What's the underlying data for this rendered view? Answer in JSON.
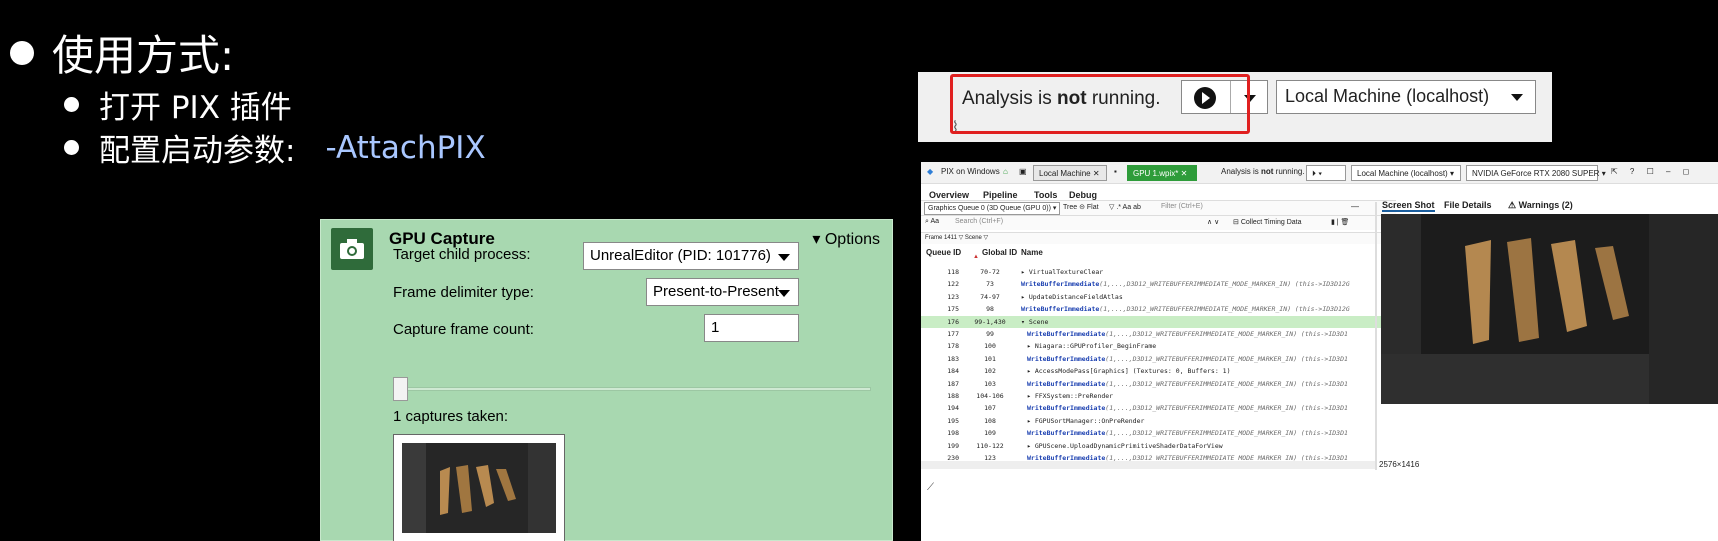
{
  "slide": {
    "title": "使用方式:",
    "bullets": [
      "打开 PIX 插件",
      "配置启动参数:"
    ],
    "param": "-AttachPIX"
  },
  "gpu_capture": {
    "title": "GPU Capture",
    "options_label": "Options",
    "target_label": "Target child process:",
    "target_value": "UnrealEditor (PID: 101776)",
    "delimiter_label": "Frame delimiter type:",
    "delimiter_value": "Present-to-Present",
    "count_label": "Capture frame count:",
    "count_value": "1",
    "captures_label": "1 captures taken:"
  },
  "analysis_bar": {
    "status_prefix": "Analysis is ",
    "status_bold": "not",
    "status_suffix": " running.",
    "machine": "Local Machine (localhost)"
  },
  "pix": {
    "app_title": "PIX on Windows",
    "tab_local": "Local Machine",
    "tab_capture": "GPU 1.wpix*",
    "status_prefix": "Analysis is ",
    "status_bold": "not",
    "status_suffix": " running.",
    "machine": "Local Machine (localhost)",
    "gpu": "NVIDIA GeForce RTX 2080 SUPER",
    "menus": [
      "Overview",
      "Pipeline",
      "Tools",
      "Debug"
    ],
    "queue_select": "Graphics Queue 0 (3D Queue (GPU 0))",
    "tree_label": "Tree",
    "flat_label": "Flat",
    "filter_placeholder": "Filter (Ctrl+E)",
    "search_placeholder": "Search (Ctrl+F)",
    "collect_label": "Collect Timing Data",
    "breadcrumb": "Frame 1411 ▽ Scene ▽",
    "columns": [
      "Queue ID",
      "Global ID",
      "Name"
    ],
    "events": [
      {
        "q": "118",
        "g": "70-72",
        "n": "▸ VirtualTextureClear",
        "blue": false,
        "indent": 0
      },
      {
        "q": "122",
        "g": "73",
        "n": "WriteBufferImmediate",
        "args": "(1,...,D3D12_WRITEBUFFERIMMEDIATE_MODE_MARKER_IN)  (this->ID3D12G",
        "blue": true,
        "indent": 0
      },
      {
        "q": "123",
        "g": "74-97",
        "n": "▸ UpdateDistanceFieldAtlas",
        "blue": false,
        "indent": 0
      },
      {
        "q": "175",
        "g": "98",
        "n": "WriteBufferImmediate",
        "args": "(1,...,D3D12_WRITEBUFFERIMMEDIATE_MODE_MARKER_IN)  (this->ID3D12G",
        "blue": true,
        "indent": 0
      },
      {
        "q": "176",
        "g": "99-1,430",
        "n": "▾ Scene",
        "blue": false,
        "indent": 0,
        "sel": true
      },
      {
        "q": "177",
        "g": "99",
        "n": "WriteBufferImmediate",
        "args": "(1,...,D3D12_WRITEBUFFERIMMEDIATE_MODE_MARKER_IN)  (this->ID3D1",
        "blue": true,
        "indent": 1
      },
      {
        "q": "178",
        "g": "100",
        "n": "▸ Niagara::GPUProfiler_BeginFrame",
        "blue": false,
        "indent": 1
      },
      {
        "q": "183",
        "g": "101",
        "n": "WriteBufferImmediate",
        "args": "(1,...,D3D12_WRITEBUFFERIMMEDIATE_MODE_MARKER_IN)  (this->ID3D1",
        "blue": true,
        "indent": 1
      },
      {
        "q": "184",
        "g": "102",
        "n": "▸ AccessModePass[Graphics] (Textures: 0, Buffers: 1)",
        "blue": false,
        "indent": 1
      },
      {
        "q": "187",
        "g": "103",
        "n": "WriteBufferImmediate",
        "args": "(1,...,D3D12_WRITEBUFFERIMMEDIATE_MODE_MARKER_IN)  (this->ID3D1",
        "blue": true,
        "indent": 1
      },
      {
        "q": "188",
        "g": "104-106",
        "n": "▸ FFXSystem::PreRender",
        "blue": false,
        "indent": 1
      },
      {
        "q": "194",
        "g": "107",
        "n": "WriteBufferImmediate",
        "args": "(1,...,D3D12_WRITEBUFFERIMMEDIATE_MODE_MARKER_IN)  (this->ID3D1",
        "blue": true,
        "indent": 1
      },
      {
        "q": "195",
        "g": "108",
        "n": "▸ FGPUSortManager::OnPreRender",
        "blue": false,
        "indent": 1
      },
      {
        "q": "198",
        "g": "109",
        "n": "WriteBufferImmediate",
        "args": "(1,...,D3D12_WRITEBUFFERIMMEDIATE_MODE_MARKER_IN)  (this->ID3D1",
        "blue": true,
        "indent": 1
      },
      {
        "q": "199",
        "g": "110-122",
        "n": "▸ GPUScene.UploadDynamicPrimitiveShaderDataForView",
        "blue": false,
        "indent": 1
      },
      {
        "q": "230",
        "g": "123",
        "n": "WriteBufferImmediate",
        "args": "(1,...,D3D12_WRITEBUFFERIMMEDIATE_MODE_MARKER_IN)  (this->ID3D1",
        "blue": true,
        "indent": 1
      }
    ],
    "right_tabs": [
      "Screen Shot",
      "File Details",
      "Warnings (2)"
    ],
    "resolution": "2576×1416"
  },
  "colors": {
    "panel_green": "#a8d8b0",
    "capture_green": "#2e9c3a",
    "highlight_red": "#e02020",
    "param_blue": "#a9c7ff"
  }
}
